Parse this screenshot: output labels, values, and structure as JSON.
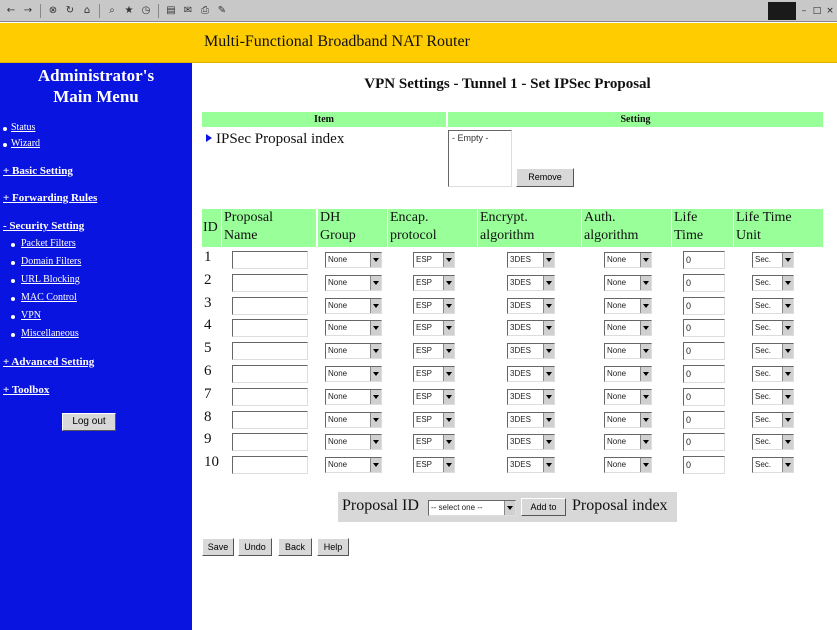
{
  "browser": {
    "toolbar_icons": [
      "back-icon",
      "forward-icon",
      "stop-icon",
      "refresh-icon",
      "home-icon",
      "search-icon",
      "favorites-icon",
      "history-icon",
      "folders-icon",
      "mail-icon",
      "print-icon",
      "edit-icon"
    ]
  },
  "banner": {
    "title": "Multi-Functional Broadband NAT Router"
  },
  "sidebar": {
    "title_line1": "Administrator's",
    "title_line2": "Main Menu",
    "status": "Status",
    "wizard": "Wizard",
    "basic": "+ Basic Setting",
    "forwarding": "+ Forwarding Rules",
    "security": "- Security Setting",
    "packet": "Packet Filters",
    "domain": "Domain Filters",
    "url": "URL Blocking",
    "mac": "MAC Control",
    "vpn": "VPN",
    "misc": "Miscellaneous",
    "advanced": "+ Advanced Setting",
    "toolbox": "+ Toolbox",
    "logout": "Log out"
  },
  "main": {
    "title": "VPN Settings - Tunnel 1 - Set IPSec Proposal",
    "col_item": "Item",
    "col_setting": "Setting",
    "index_label": "IPSec Proposal index",
    "list_empty": "- Empty -",
    "remove": "Remove"
  },
  "grid": {
    "headers": {
      "id": "ID",
      "name1": "Proposal",
      "name2": "Name",
      "dh1": "DH",
      "dh2": "Group",
      "encap1": "Encap.",
      "encap2": "protocol",
      "encrypt1": "Encrypt.",
      "encrypt2": "algorithm",
      "auth1": "Auth.",
      "auth2": "algorithm",
      "life1": "Life",
      "life2": "Time",
      "unit1": "Life Time",
      "unit2": "Unit"
    },
    "rows": [
      {
        "id": "1",
        "name": "",
        "dh": "None",
        "encap": "ESP",
        "encrypt": "3DES",
        "auth": "None",
        "life": "0",
        "unit": "Sec."
      },
      {
        "id": "2",
        "name": "",
        "dh": "None",
        "encap": "ESP",
        "encrypt": "3DES",
        "auth": "None",
        "life": "0",
        "unit": "Sec."
      },
      {
        "id": "3",
        "name": "",
        "dh": "None",
        "encap": "ESP",
        "encrypt": "3DES",
        "auth": "None",
        "life": "0",
        "unit": "Sec."
      },
      {
        "id": "4",
        "name": "",
        "dh": "None",
        "encap": "ESP",
        "encrypt": "3DES",
        "auth": "None",
        "life": "0",
        "unit": "Sec."
      },
      {
        "id": "5",
        "name": "",
        "dh": "None",
        "encap": "ESP",
        "encrypt": "3DES",
        "auth": "None",
        "life": "0",
        "unit": "Sec."
      },
      {
        "id": "6",
        "name": "",
        "dh": "None",
        "encap": "ESP",
        "encrypt": "3DES",
        "auth": "None",
        "life": "0",
        "unit": "Sec."
      },
      {
        "id": "7",
        "name": "",
        "dh": "None",
        "encap": "ESP",
        "encrypt": "3DES",
        "auth": "None",
        "life": "0",
        "unit": "Sec."
      },
      {
        "id": "8",
        "name": "",
        "dh": "None",
        "encap": "ESP",
        "encrypt": "3DES",
        "auth": "None",
        "life": "0",
        "unit": "Sec."
      },
      {
        "id": "9",
        "name": "",
        "dh": "None",
        "encap": "ESP",
        "encrypt": "3DES",
        "auth": "None",
        "life": "0",
        "unit": "Sec."
      },
      {
        "id": "10",
        "name": "",
        "dh": "None",
        "encap": "ESP",
        "encrypt": "3DES",
        "auth": "None",
        "life": "0",
        "unit": "Sec."
      }
    ]
  },
  "proposal": {
    "label": "Proposal ID",
    "select": "-- select one --",
    "add": "Add to",
    "suffix": "Proposal index"
  },
  "actions": {
    "save": "Save",
    "undo": "Undo",
    "back": "Back",
    "help": "Help"
  },
  "colors": {
    "banner": "#ffcc00",
    "sidebar": "#0a14e0",
    "header_green": "#99ff99"
  }
}
